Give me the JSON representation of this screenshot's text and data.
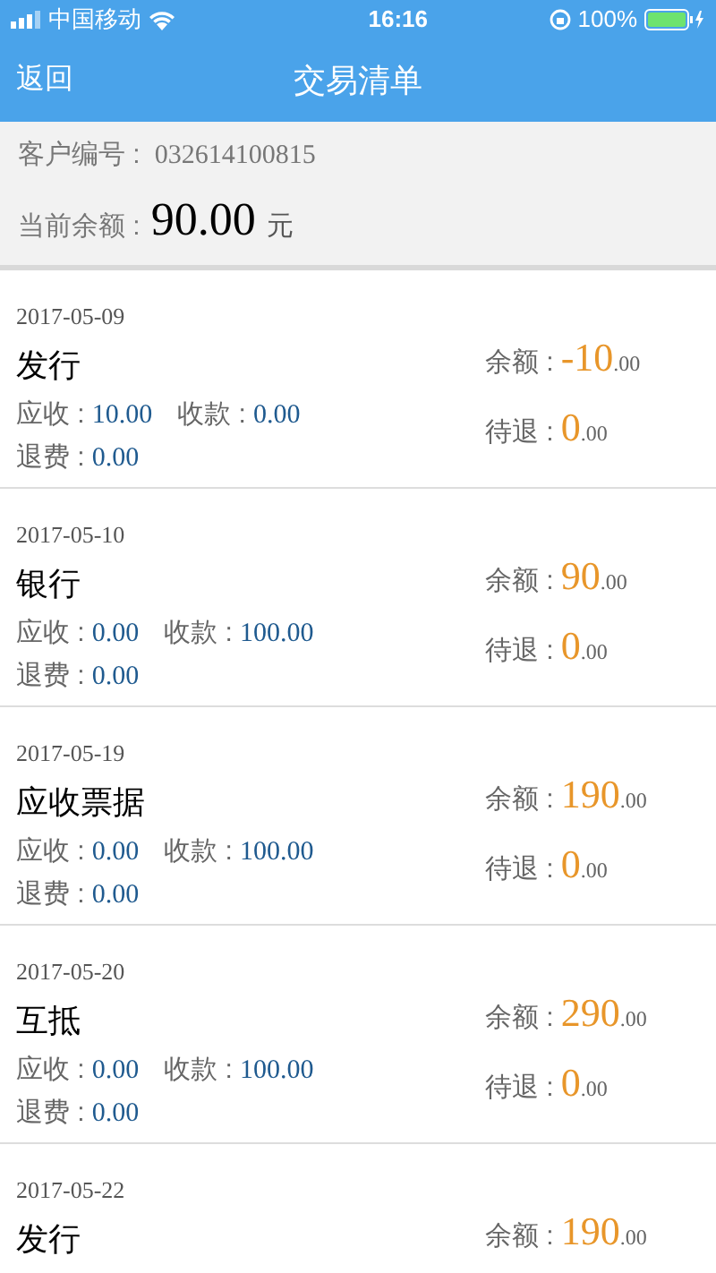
{
  "status_bar": {
    "carrier": "中国移动",
    "time": "16:16",
    "battery": "100%"
  },
  "nav": {
    "back": "返回",
    "title": "交易清单"
  },
  "summary": {
    "customer_label": "客户编号 :",
    "customer_no": "032614100815",
    "balance_label": "当前余额 :",
    "balance": "90.00",
    "unit": "元"
  },
  "transactions": [
    {
      "date": "2017-05-09",
      "title": "发行",
      "receivable_label": "应收 :",
      "receivable": "10.00",
      "received_label": "收款 :",
      "received": "0.00",
      "refund_label": "退费 :",
      "refund": "0.00",
      "balance_label": "余额 :",
      "balance_int": "-10",
      "balance_dec": ".00",
      "pending_label": "待退 :",
      "pending_int": "0",
      "pending_dec": ".00"
    },
    {
      "date": "2017-05-10",
      "title": "银行",
      "receivable_label": "应收 :",
      "receivable": "0.00",
      "received_label": "收款 :",
      "received": "100.00",
      "refund_label": "退费 :",
      "refund": "0.00",
      "balance_label": "余额 :",
      "balance_int": "90",
      "balance_dec": ".00",
      "pending_label": "待退 :",
      "pending_int": "0",
      "pending_dec": ".00"
    },
    {
      "date": "2017-05-19",
      "title": "应收票据",
      "receivable_label": "应收 :",
      "receivable": "0.00",
      "received_label": "收款 :",
      "received": "100.00",
      "refund_label": "退费 :",
      "refund": "0.00",
      "balance_label": "余额 :",
      "balance_int": "190",
      "balance_dec": ".00",
      "pending_label": "待退 :",
      "pending_int": "0",
      "pending_dec": ".00"
    },
    {
      "date": "2017-05-20",
      "title": "互抵",
      "receivable_label": "应收 :",
      "receivable": "0.00",
      "received_label": "收款 :",
      "received": "100.00",
      "refund_label": "退费 :",
      "refund": "0.00",
      "balance_label": "余额 :",
      "balance_int": "290",
      "balance_dec": ".00",
      "pending_label": "待退 :",
      "pending_int": "0",
      "pending_dec": ".00"
    },
    {
      "date": "2017-05-22",
      "title": "发行",
      "balance_label": "余额 :",
      "balance_int": "190",
      "balance_dec": ".00"
    }
  ]
}
